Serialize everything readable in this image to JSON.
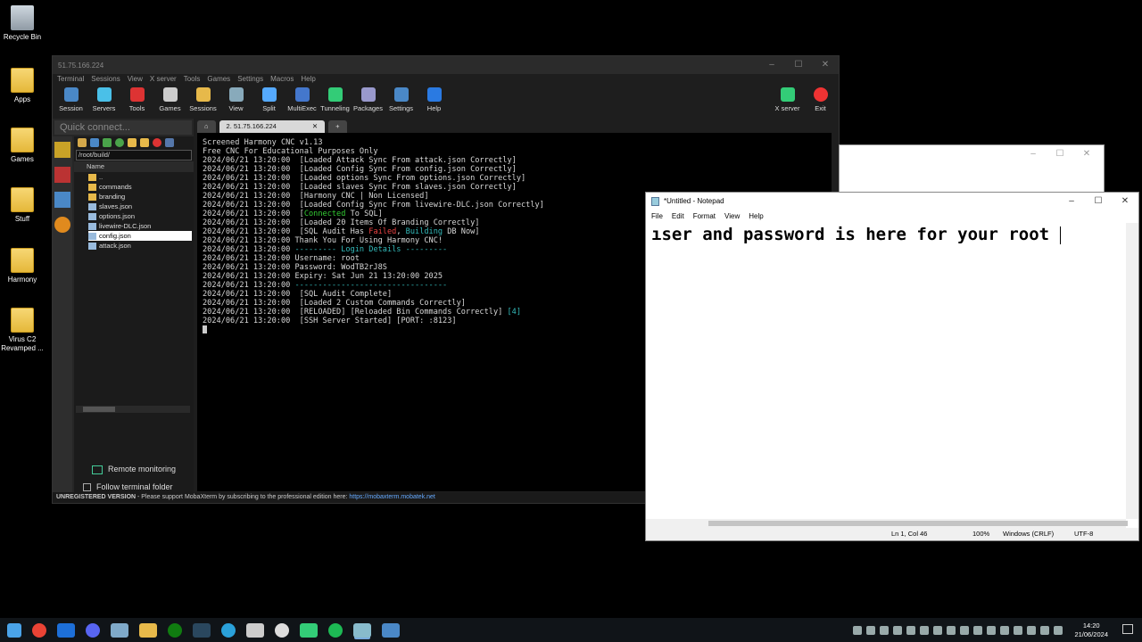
{
  "desktop": {
    "icons": [
      {
        "label": "Recycle Bin",
        "kind": "bin"
      },
      {
        "label": "Apps",
        "kind": "folder"
      },
      {
        "label": "Games",
        "kind": "folder"
      },
      {
        "label": "Stuff",
        "kind": "folder"
      },
      {
        "label": "Harmony",
        "kind": "folder"
      },
      {
        "label": "Virus C2 Revamped ...",
        "kind": "folder"
      }
    ]
  },
  "moba": {
    "title": "51.75.166.224",
    "menu": [
      "Terminal",
      "Sessions",
      "View",
      "X server",
      "Tools",
      "Games",
      "Settings",
      "Macros",
      "Help"
    ],
    "toolbar": [
      "Session",
      "Servers",
      "Tools",
      "Games",
      "Sessions",
      "View",
      "Split",
      "MultiExec",
      "Tunneling",
      "Packages",
      "Settings",
      "Help"
    ],
    "toolbar_right": [
      "X server",
      "Exit"
    ],
    "quick_connect": "Quick connect...",
    "path": "/root/build/",
    "tree_header": "Name",
    "files": [
      {
        "name": "..",
        "dir": true
      },
      {
        "name": "commands",
        "dir": true
      },
      {
        "name": "branding",
        "dir": true
      },
      {
        "name": "slaves.json",
        "dir": false
      },
      {
        "name": "options.json",
        "dir": false
      },
      {
        "name": "livewire-DLC.json",
        "dir": false
      },
      {
        "name": "config.json",
        "dir": false,
        "selected": true
      },
      {
        "name": "attack.json",
        "dir": false
      }
    ],
    "remote_monitoring": "Remote monitoring",
    "follow_folder": "Follow terminal folder",
    "tab_label": "2. 51.75.166.224",
    "status_text": "UNREGISTERED VERSION",
    "status_msg": "  -  Please support MobaXterm by subscribing to the professional edition here:  ",
    "status_link": "https://mobaxterm.mobatek.net",
    "terminal": [
      "Screened Harmony CNC v1.13",
      "Free CNC For Educational Purposes Only",
      "",
      "2024/06/21 13:20:00  [Loaded Attack Sync From attack.json Correctly]",
      "2024/06/21 13:20:00  [Loaded Config Sync From config.json Correctly]",
      "2024/06/21 13:20:00  [Loaded options Sync From options.json Correctly]",
      "2024/06/21 13:20:00  [Loaded slaves Sync From slaves.json Correctly]",
      "2024/06/21 13:20:00  [Harmony CNC | Non Licensed]",
      "2024/06/21 13:20:00  [Loaded Config Sync From livewire-DLC.json Correctly]",
      "2024/06/21 13:20:00  [Connected To SQL]",
      "2024/06/21 13:20:00  [Loaded 20 Items Of Branding Correctly]",
      "2024/06/21 13:20:00  [SQL Audit Has Failed, Building DB Now]",
      "2024/06/21 13:20:00 Thank You For Using Harmony CNC!",
      "2024/06/21 13:20:00 --------- Login Details ---------",
      "2024/06/21 13:20:00 Username: root",
      "2024/06/21 13:20:00 Password: WodTB2rJ8S",
      "2024/06/21 13:20:00 Expiry: Sat Jun 21 13:20:00 2025",
      "2024/06/21 13:20:00 ---------------------------------",
      "2024/06/21 13:20:00  [SQL Audit Complete]",
      "2024/06/21 13:20:00  [Loaded 2 Custom Commands Correctly]",
      "2024/06/21 13:20:00  [RELOADED] [Reloaded Bin Commands Correctly] [4]",
      "2024/06/21 13:20:00  [SSH Server Started] [PORT: :8123]"
    ]
  },
  "notepad": {
    "title": "*Untitled - Notepad",
    "menu": [
      "File",
      "Edit",
      "Format",
      "View",
      "Help"
    ],
    "content": "ıser and password is here for your root ",
    "status": {
      "pos": "Ln 1, Col 46",
      "zoom": "100%",
      "eol": "Windows (CRLF)",
      "enc": "UTF-8"
    }
  },
  "taskbar": {
    "time": "14:20",
    "date": "21/06/2024"
  }
}
